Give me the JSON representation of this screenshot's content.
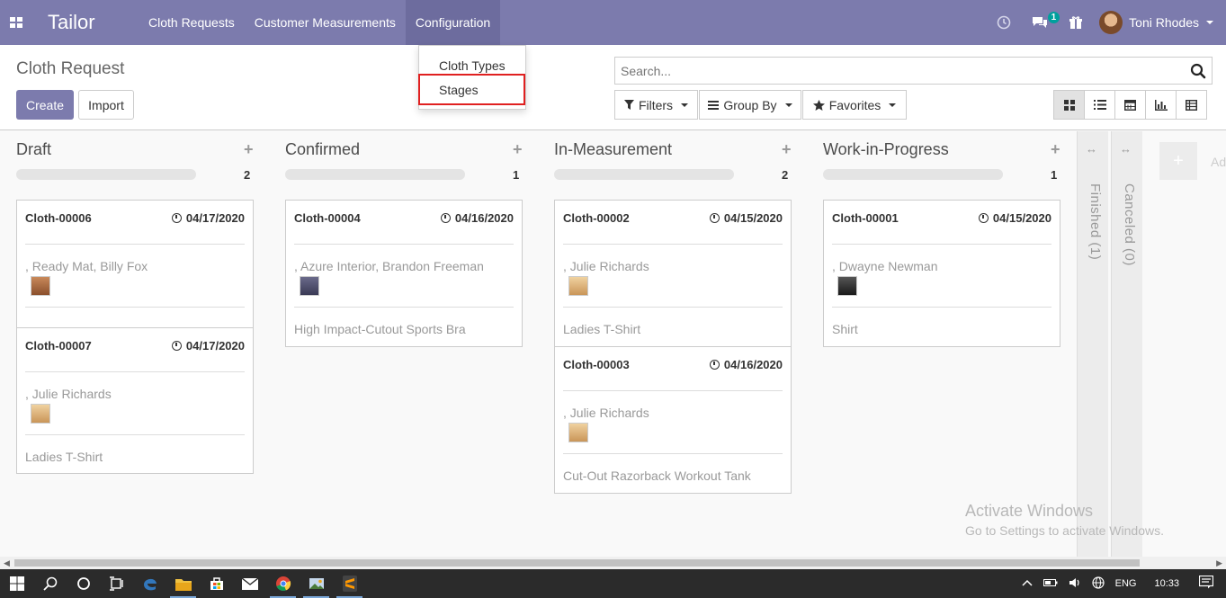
{
  "navbar": {
    "brand": "Tailor",
    "menu": [
      "Cloth Requests",
      "Customer Measurements",
      "Configuration"
    ],
    "chat_badge": "1",
    "user_name": "Toni Rhodes"
  },
  "dropdown": {
    "items": [
      "Cloth Types",
      "Stages"
    ]
  },
  "control": {
    "breadcrumb": "Cloth Request",
    "create_label": "Create",
    "import_label": "Import",
    "search_placeholder": "Search...",
    "filters_label": "Filters",
    "groupby_label": "Group By",
    "favorites_label": "Favorites"
  },
  "columns": [
    {
      "title": "Draft",
      "count": "2",
      "cards": [
        {
          "name": "Cloth-00006",
          "date": "04/17/2020",
          "partner": ", Ready Mat, Billy Fox",
          "product": ""
        },
        {
          "name": "Cloth-00007",
          "date": "04/17/2020",
          "partner": ", Julie Richards",
          "product": "Ladies T-Shirt"
        }
      ]
    },
    {
      "title": "Confirmed",
      "count": "1",
      "cards": [
        {
          "name": "Cloth-00004",
          "date": "04/16/2020",
          "partner": ", Azure Interior, Brandon Freeman",
          "product": "High Impact-Cutout Sports Bra"
        }
      ]
    },
    {
      "title": "In-Measurement",
      "count": "2",
      "cards": [
        {
          "name": "Cloth-00002",
          "date": "04/15/2020",
          "partner": ", Julie Richards",
          "product": "Ladies T-Shirt"
        },
        {
          "name": "Cloth-00003",
          "date": "04/16/2020",
          "partner": ", Julie Richards",
          "product": "Cut-Out Razorback Workout Tank"
        }
      ]
    },
    {
      "title": "Work-in-Progress",
      "count": "1",
      "cards": [
        {
          "name": "Cloth-00001",
          "date": "04/15/2020",
          "partner": ", Dwayne Newman",
          "product": "Shirt"
        }
      ]
    }
  ],
  "folded_columns": [
    "Finished (1)",
    "Canceled (0)"
  ],
  "add_column_label": "Ad",
  "watermark": {
    "line1": "Activate Windows",
    "line2": "Go to Settings to activate Windows."
  },
  "taskbar": {
    "language": "ENG",
    "time": "10:33"
  }
}
